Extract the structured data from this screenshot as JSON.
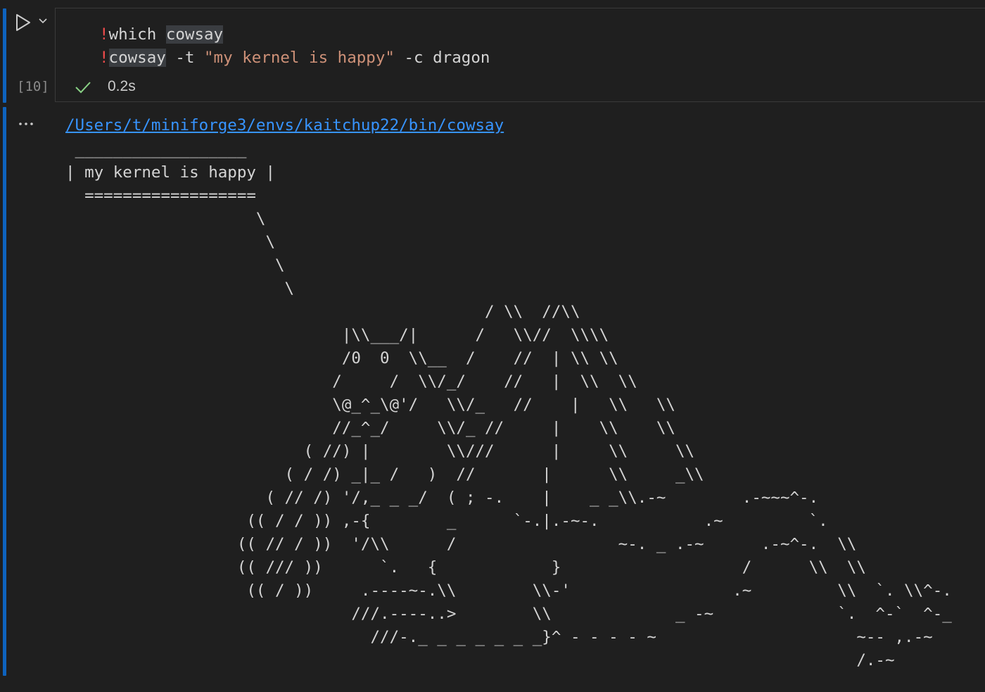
{
  "cell": {
    "execution_count": "[10]",
    "exec_time": "0.2s",
    "code": {
      "line1": {
        "bang": "!",
        "cmd": "which ",
        "arg": "cowsay"
      },
      "line2": {
        "bang": "!",
        "cmd": "cowsay",
        "flag1": " -t ",
        "str": "\"my kernel is happy\"",
        "flag2": " -c dragon"
      }
    }
  },
  "output": {
    "path": "/Users/t/miniforge3/envs/kaitchup22/bin/cowsay",
    "ascii_art": " __________________\n| my kernel is happy |\n  ==================\n                    \\\n                     \\\n                      \\\n                       \\\n                                            / \\\\  //\\\\\n                             |\\\\___/|      /   \\\\//  \\\\\\\\\n                             /0  0  \\\\__  /    //  | \\\\ \\\\\n                            /     /  \\\\/_/    //   |  \\\\  \\\\\n                            \\@_^_\\@'/   \\\\/_   //    |   \\\\   \\\\\n                            //_^_/     \\\\/_ //     |    \\\\    \\\\\n                         ( //) |        \\\\///      |     \\\\     \\\\\n                       ( / /) _|_ /   )  //       |      \\\\     _\\\\\n                     ( // /) '/,_ _ _/  ( ; -.    |    _ _\\\\.-~        .-~~~^-.\n                   (( / / )) ,-{        _      `-.|.-~-.           .~         `.\n                  (( // / ))  '/\\\\      /                 ~-. _ .-~      .-~^-.  \\\\\n                  (( /// ))      `.   {            }                   /      \\\\  \\\\\n                   (( / ))     .----~-.\\\\        \\\\-'                 .~         \\\\  `. \\\\^-.\n                              ///.----..>        \\\\             _ -~             `.  ^-`  ^-_\n                                ///-._ _ _ _ _ _ _}^ - - - - ~                     ~-- ,.-~\n                                                                                   /.-~",
    "colors": {
      "link": "#3794ff",
      "text": "#d4d4d4",
      "bang": "#f14c4c",
      "string": "#ce9178",
      "check": "#89d185",
      "focus": "#0e63be"
    }
  }
}
